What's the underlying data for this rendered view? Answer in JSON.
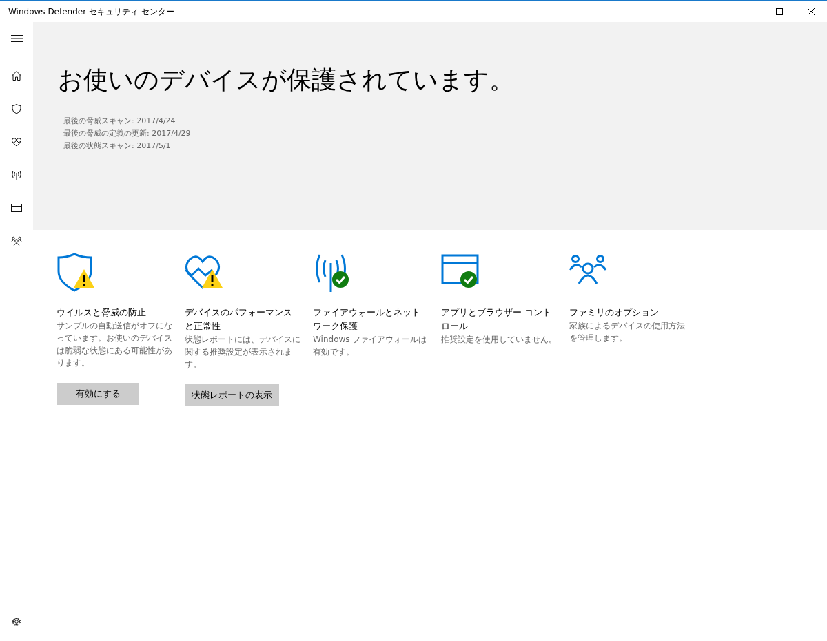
{
  "window": {
    "title": "Windows Defender セキュリティ センター"
  },
  "hero": {
    "heading": "お使いのデバイスが保護されています。",
    "details": [
      "最後の脅威スキャン: 2017/4/24",
      "最後の脅威の定義の更新: 2017/4/29",
      "最後の状態スキャン: 2017/5/1"
    ]
  },
  "tiles": [
    {
      "kind": "virus",
      "warning": true,
      "ok": false,
      "title": "ウイルスと脅威の防止",
      "description": "サンプルの自動送信がオフになっています。お使いのデバイスは脆弱な状態にある可能性があります。",
      "button": "有効にする"
    },
    {
      "kind": "health",
      "warning": true,
      "ok": false,
      "title": "デバイスのパフォーマンスと正常性",
      "description": "状態レポートには、デバイスに関する推奨設定が表示されます。",
      "button": "状態レポートの表示"
    },
    {
      "kind": "firewall",
      "warning": false,
      "ok": true,
      "title": "ファイアウォールとネットワーク保護",
      "description": "Windows ファイアウォールは有効です。"
    },
    {
      "kind": "app",
      "warning": false,
      "ok": true,
      "title": "アプリとブラウザー コントロール",
      "description": "推奨設定を使用していません。"
    },
    {
      "kind": "family",
      "warning": false,
      "ok": false,
      "title": "ファミリのオプション",
      "description": "家族によるデバイスの使用方法を管理します。"
    }
  ]
}
